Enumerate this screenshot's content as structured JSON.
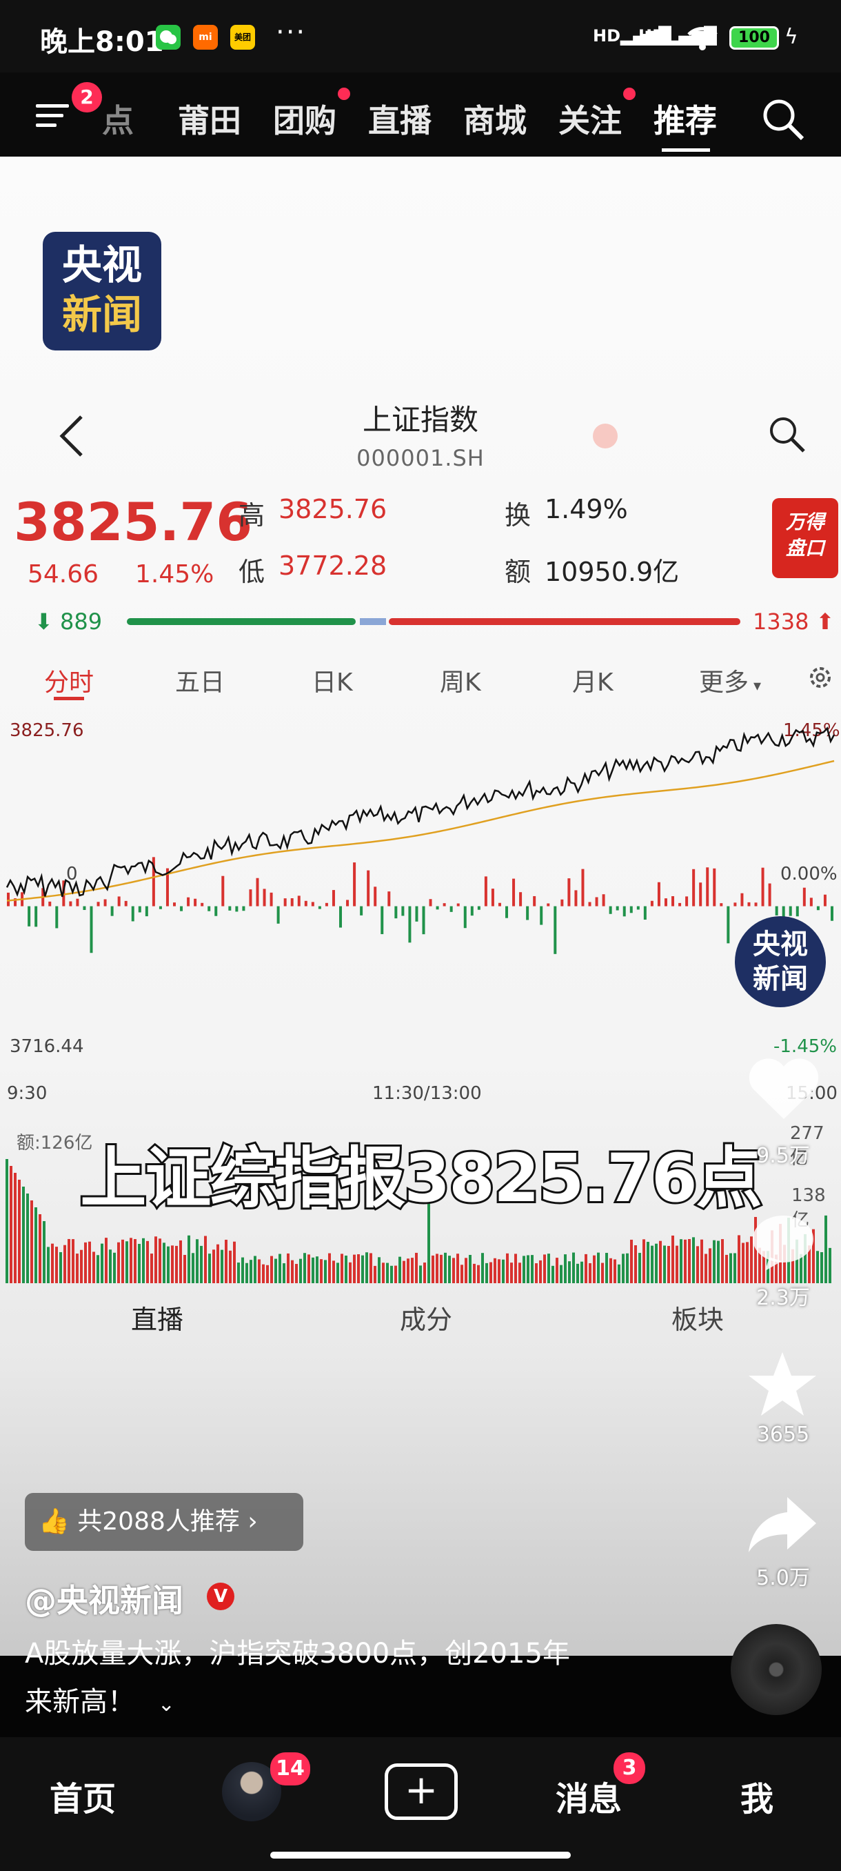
{
  "status_bar": {
    "time": "晚上8:01",
    "app_icons": [
      "wechat-icon",
      "mi-icon",
      "meituan-icon"
    ],
    "meituan_label": "美团",
    "mi_label": "mi",
    "more": "···",
    "network_1": "HD",
    "network_2": "HD",
    "battery": "100"
  },
  "top_nav": {
    "menu_badge": "2",
    "tabs": [
      {
        "label": "热点",
        "partial": "点",
        "dot": false
      },
      {
        "label": "莆田",
        "dot": false
      },
      {
        "label": "团购",
        "dot": true
      },
      {
        "label": "直播",
        "dot": false
      },
      {
        "label": "商城",
        "dot": false
      },
      {
        "label": "关注",
        "dot": true
      },
      {
        "label": "推荐",
        "dot": false,
        "active": true
      }
    ]
  },
  "logo": {
    "line1": "央视",
    "line2": "新闻"
  },
  "stock": {
    "name": "上证指数",
    "code": "000001.SH",
    "price": "3825.76",
    "change": "54.66",
    "change_pct": "1.45%",
    "high_label": "高",
    "high": "3825.76",
    "low_label": "低",
    "low": "3772.28",
    "turnover_label": "换",
    "turnover": "1.49%",
    "amount_label": "额",
    "amount": "10950.9亿",
    "down_count": "889",
    "up_count": "1338",
    "badge_line1": "万得",
    "badge_line2": "盘口",
    "periods": [
      "分时",
      "五日",
      "日K",
      "周K",
      "月K",
      "更多"
    ],
    "axis_top": "3825.76",
    "axis_top_right": "1.45%",
    "axis_bottom": "3716.44",
    "axis_bottom_right": "-1.45%",
    "axis_mid_left": "0",
    "axis_mid_right": "0.00%",
    "time_start": "9:30",
    "time_mid": "11:30/13:00",
    "time_end": "15:00",
    "volume_label": "额:126亿",
    "vol_right_1": "277亿",
    "vol_right_2": "138亿",
    "bottom_tabs": [
      "直播",
      "成分",
      "板块"
    ]
  },
  "caption": "上证综指报3825.76点",
  "side_actions": {
    "likes": "9.5万",
    "comments": "2.3万",
    "favorites": "3655",
    "shares": "5.0万"
  },
  "recommend": "共2088人推荐",
  "author": "@央视新闻",
  "description_line1": "A股放量大涨，沪指突破3800点，创2015年",
  "description_line2": "来新高！",
  "bottom_nav": {
    "home": "首页",
    "friends_badge": "14",
    "messages": "消息",
    "messages_badge": "3",
    "me": "我"
  },
  "colors": {
    "up": "#d8322f",
    "down": "#20924a",
    "accent": "#fe2c55",
    "price_line": "#111111",
    "avg_line": "#e0a020"
  }
}
